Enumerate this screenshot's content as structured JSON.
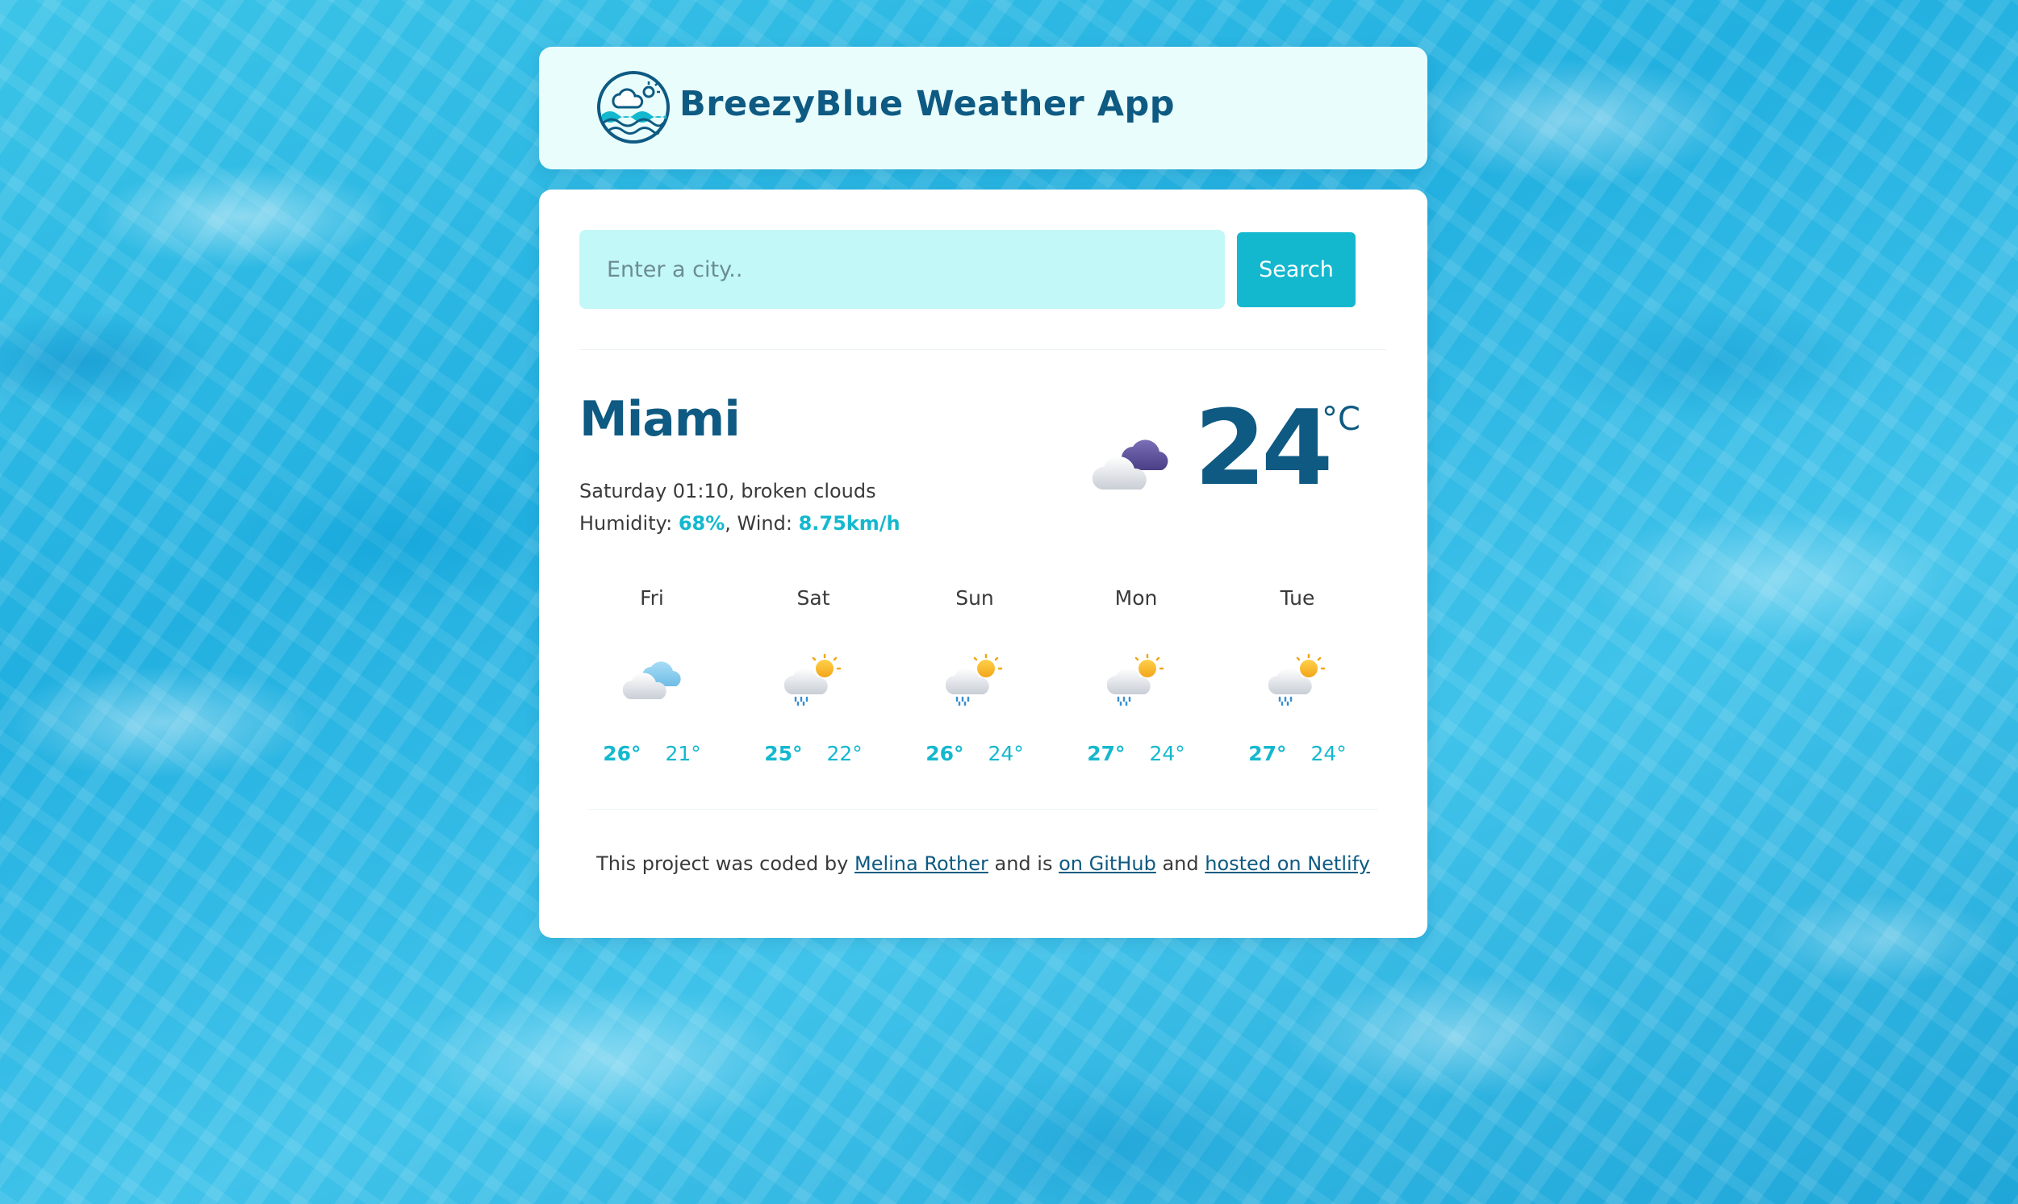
{
  "header": {
    "title": "BreezyBlue Weather App",
    "logo_icon": "wave-cloud-sun-logo-icon"
  },
  "search": {
    "placeholder": "Enter a city..",
    "value": "",
    "button_label": "Search"
  },
  "current": {
    "city": "Miami",
    "datetime": "Saturday 01:10",
    "description": "broken clouds",
    "humidity_label": "Humidity:",
    "humidity": "68%",
    "wind_label": "Wind:",
    "wind": "8.75km/h",
    "temperature": "24",
    "unit": "°C",
    "icon": "broken-clouds-icon"
  },
  "forecast": [
    {
      "day": "Fri",
      "max": "26°",
      "min": "21°",
      "icon": "cloudy-icon"
    },
    {
      "day": "Sat",
      "max": "25°",
      "min": "22°",
      "icon": "sun-cloud-rain-icon"
    },
    {
      "day": "Sun",
      "max": "26°",
      "min": "24°",
      "icon": "sun-cloud-rain-icon"
    },
    {
      "day": "Mon",
      "max": "27°",
      "min": "24°",
      "icon": "sun-cloud-rain-icon"
    },
    {
      "day": "Tue",
      "max": "27°",
      "min": "24°",
      "icon": "sun-cloud-rain-icon"
    }
  ],
  "footer": {
    "prefix": "This project was coded by",
    "author_link": "Melina Rother",
    "middle": "and is",
    "github_link": "on GitHub",
    "and": "and",
    "netlify_link": "hosted on Netlify"
  },
  "colors": {
    "brand_dark": "#0e5a82",
    "accent": "#14b8ce",
    "input_bg": "#c3f8f8",
    "header_bg": "#e9fdfd"
  }
}
